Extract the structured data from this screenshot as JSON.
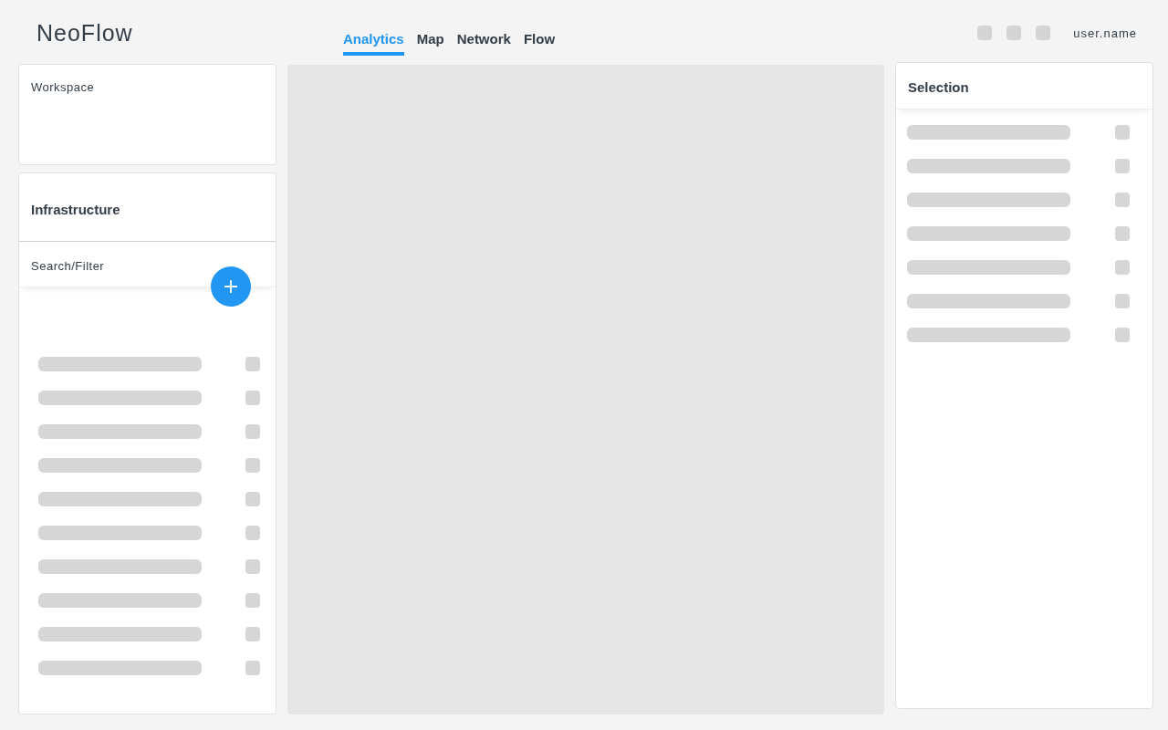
{
  "header": {
    "logo": "NeoFlow",
    "tabs": [
      {
        "label": "Analytics",
        "selected": true
      },
      {
        "label": "Map",
        "selected": false
      },
      {
        "label": "Network",
        "selected": false
      },
      {
        "label": "Flow",
        "selected": false
      }
    ],
    "user": "user.name"
  },
  "workspace": {
    "title": "Workspace"
  },
  "infrastructure": {
    "title": "Infrastructure",
    "search": {
      "placeholder": "Search/Filter"
    },
    "rows": [
      {
        "kind": "skeleton"
      },
      {
        "kind": "skeleton"
      },
      {
        "kind": "skeleton"
      },
      {
        "kind": "skeleton"
      },
      {
        "kind": "skeleton"
      },
      {
        "kind": "skeleton"
      },
      {
        "kind": "skeleton"
      },
      {
        "kind": "skeleton"
      },
      {
        "kind": "skeleton"
      },
      {
        "kind": "skeleton"
      }
    ]
  },
  "selection": {
    "title": "Selection",
    "rows": [
      {
        "kind": "skeleton"
      },
      {
        "kind": "skeleton"
      },
      {
        "kind": "skeleton"
      },
      {
        "kind": "skeleton"
      },
      {
        "kind": "skeleton"
      },
      {
        "kind": "skeleton"
      },
      {
        "kind": "skeleton"
      }
    ]
  }
}
